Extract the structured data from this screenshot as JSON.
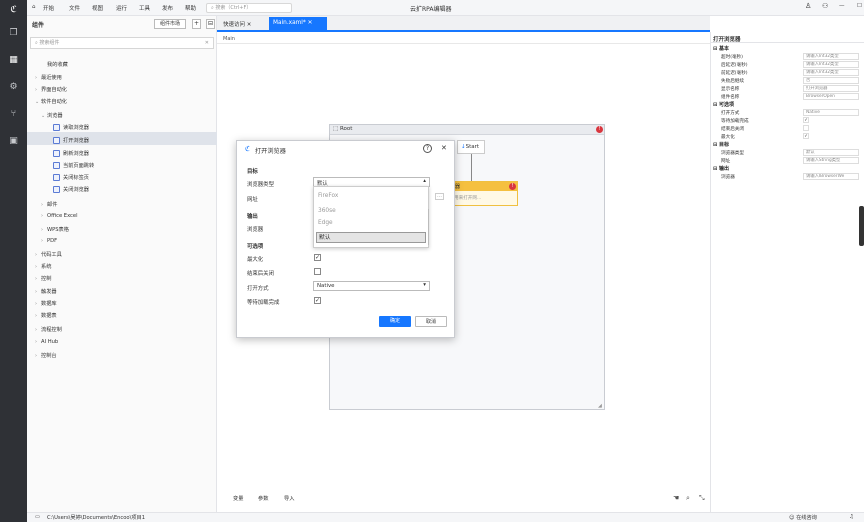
{
  "titlebar": {
    "menus": [
      "开始",
      "文件",
      "视图",
      "运行",
      "工具",
      "发布",
      "帮助"
    ],
    "search_placeholder": "搜索（Ctrl+F）",
    "app_title": "云扩RPA编辑器"
  },
  "components": {
    "title": "组件",
    "market_button": "组件市场",
    "search_placeholder": "搜索组件",
    "tree": [
      {
        "label": "我的收藏",
        "level": 1,
        "chev": ""
      },
      {
        "label": "最近使用",
        "level": 0,
        "chev": "›"
      },
      {
        "label": "界面自动化",
        "level": 0,
        "chev": "›"
      },
      {
        "label": "软件自动化",
        "level": 0,
        "chev": "⌄"
      },
      {
        "label": "浏览器",
        "level": 1,
        "chev": "⌄"
      },
      {
        "label": "读取浏览器",
        "level": 2,
        "chev": ""
      },
      {
        "label": "打开浏览器",
        "level": 2,
        "chev": "",
        "selected": true
      },
      {
        "label": "刷新浏览器",
        "level": 2,
        "chev": ""
      },
      {
        "label": "当前页面跳转",
        "level": 2,
        "chev": ""
      },
      {
        "label": "关闭标签页",
        "level": 2,
        "chev": ""
      },
      {
        "label": "关闭浏览器",
        "level": 2,
        "chev": ""
      },
      {
        "label": "邮件",
        "level": 1,
        "chev": "›"
      },
      {
        "label": "Office Excel",
        "level": 1,
        "chev": "›"
      },
      {
        "label": "WPS表格",
        "level": 1,
        "chev": "›"
      },
      {
        "label": "PDF",
        "level": 1,
        "chev": "›"
      },
      {
        "label": "代码工具",
        "level": 0,
        "chev": "›"
      },
      {
        "label": "系统",
        "level": 0,
        "chev": "›"
      },
      {
        "label": "控制",
        "level": 0,
        "chev": "›"
      },
      {
        "label": "触发器",
        "level": 0,
        "chev": "›"
      },
      {
        "label": "数据库",
        "level": 0,
        "chev": "›"
      },
      {
        "label": "数据表",
        "level": 0,
        "chev": "›"
      },
      {
        "label": "流程控制",
        "level": 0,
        "chev": "›"
      },
      {
        "label": "AI Hub",
        "level": 0,
        "chev": "›"
      },
      {
        "label": "控制台",
        "level": 0,
        "chev": "›"
      }
    ]
  },
  "tabs": {
    "quick": "快速访问",
    "main": "Main.xaml*"
  },
  "canvas": {
    "breadcrumb": "Main",
    "root_label": "Root",
    "start_label": "Start",
    "node_title": "器",
    "node_sub": "用来打开网...",
    "bottom_tabs": [
      "变量",
      "参数",
      "导入"
    ]
  },
  "dialog": {
    "title": "打开浏览器",
    "sec_target": "目标",
    "browser_type_label": "浏览器类型",
    "browser_type_value": "默认",
    "url_label": "网址",
    "sec_output": "输出",
    "browser_label": "浏览器",
    "sec_optional": "可选项",
    "maximize_label": "最大化",
    "close_after_label": "结束后关闭",
    "open_mode_label": "打开方式",
    "open_mode_value": "Native",
    "wait_label": "等待加载完成",
    "ok_label": "确定",
    "cancel_label": "取消"
  },
  "dropdown": {
    "options": [
      "FireFox",
      "360se",
      "Edge",
      "默认"
    ],
    "selected_index": 3
  },
  "properties": {
    "title": "打开浏览器",
    "sections": [
      {
        "title": "基本",
        "rows": [
          {
            "k": "超时(毫秒)",
            "v": "请输入Int32类型"
          },
          {
            "k": "后延迟(毫秒)",
            "v": "请输入Int32类型"
          },
          {
            "k": "前延迟(毫秒)",
            "v": "请输入Int32类型"
          },
          {
            "k": "失败后继续",
            "v": "否"
          },
          {
            "k": "显示名称",
            "v": "打开浏览器"
          },
          {
            "k": "组件名称",
            "v": "BrowserOpen"
          }
        ]
      },
      {
        "title": "可选项",
        "rows": [
          {
            "k": "打开方式",
            "v": "Native"
          },
          {
            "k": "等待加载完成",
            "v": "✓"
          },
          {
            "k": "结束后关闭",
            "v": ""
          },
          {
            "k": "最大化",
            "v": "✓"
          }
        ]
      },
      {
        "title": "目标",
        "rows": [
          {
            "k": "浏览器类型",
            "v": "默认"
          },
          {
            "k": "网址",
            "v": "请输入String类型"
          }
        ]
      },
      {
        "title": "输出",
        "rows": [
          {
            "k": "浏览器",
            "v": "请输入IBrowserWe"
          }
        ]
      }
    ]
  },
  "statusbar": {
    "path": "C:\\Users\\吴婷\\Documents\\Encoo\\项目1",
    "help": "在线咨询"
  }
}
